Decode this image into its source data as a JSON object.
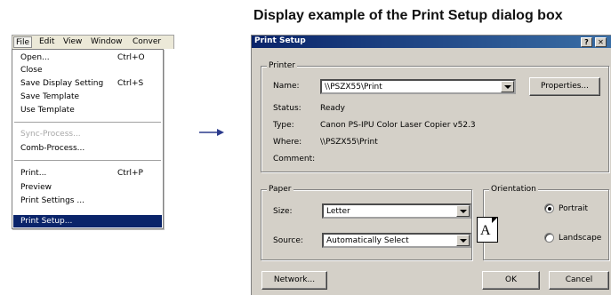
{
  "heading": "Display example of the Print Setup dialog box",
  "menubar": {
    "items": [
      "File",
      "Edit",
      "View",
      "Window",
      "Conver"
    ]
  },
  "file_menu": {
    "items": [
      {
        "label": "Open...",
        "shortcut": "Ctrl+O"
      },
      {
        "label": "Close",
        "shortcut": ""
      },
      {
        "label": "Save Display Setting",
        "shortcut": "Ctrl+S"
      },
      {
        "label": "Save Template",
        "shortcut": ""
      },
      {
        "label": "Use Template",
        "shortcut": ""
      },
      {
        "label": "Sync-Process...",
        "shortcut": ""
      },
      {
        "label": "Comb-Process...",
        "shortcut": ""
      },
      {
        "label": "Print...",
        "shortcut": "Ctrl+P"
      },
      {
        "label": "Preview",
        "shortcut": ""
      },
      {
        "label": "Print Settings ...",
        "shortcut": ""
      },
      {
        "label": "Print Setup...",
        "shortcut": ""
      }
    ],
    "selected_item": "Print Setup...",
    "disabled_item": "Sync-Process..."
  },
  "dialog": {
    "title": "Print Setup",
    "help_button": "?",
    "printer": {
      "group_label": "Printer",
      "name_label": "Name:",
      "name_value": "\\\\PSZX55\\Print",
      "properties_button": "Properties...",
      "status_label": "Status:",
      "status_value": "Ready",
      "type_label": "Type:",
      "type_value": "Canon PS-IPU Color Laser Copier v52.3",
      "where_label": "Where:",
      "where_value": "\\\\PSZX55\\Print",
      "comment_label": "Comment:",
      "comment_value": ""
    },
    "paper": {
      "group_label": "Paper",
      "size_label": "Size:",
      "size_value": "Letter",
      "source_label": "Source:",
      "source_value": "Automatically Select"
    },
    "orientation": {
      "group_label": "Orientation",
      "page_icon_letter": "A",
      "portrait_label": "Portrait",
      "landscape_label": "Landscape",
      "selected": "Portrait"
    },
    "network_button": "Network...",
    "ok_button": "OK",
    "cancel_button": "Cancel"
  },
  "colors": {
    "menu_highlight": "#0a246a",
    "titlebar": "#0a246a",
    "dialog_face": "#d4d0c8",
    "arrow": "#2b3a8c"
  }
}
